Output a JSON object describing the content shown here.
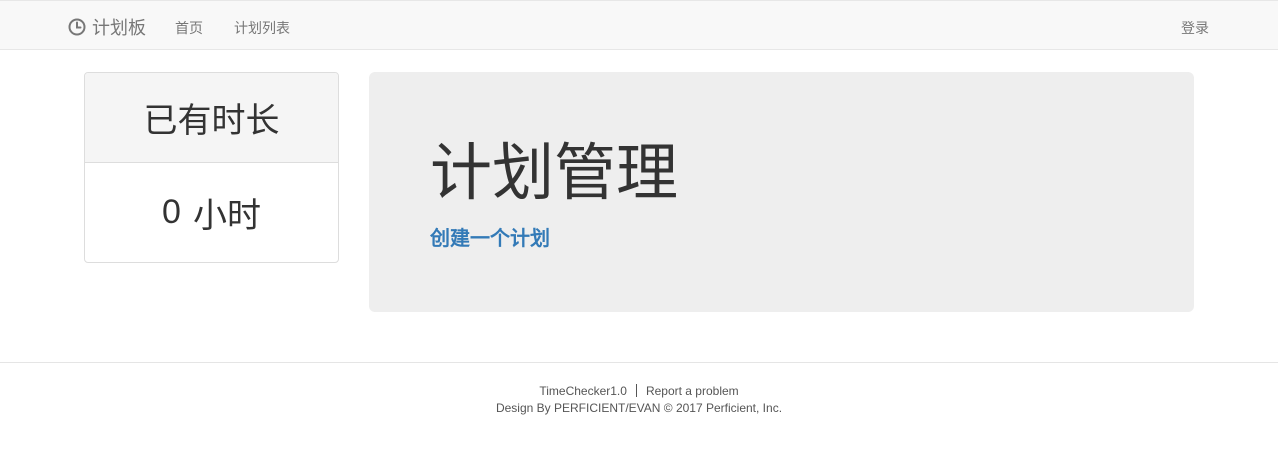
{
  "navbar": {
    "brand_icon": "clock-icon",
    "brand_label": "计划板",
    "home_label": "首页",
    "plan_list_label": "计划列表",
    "login_label": "登录"
  },
  "hours_panel": {
    "heading": "已有时长",
    "value": "0",
    "unit": "小时"
  },
  "jumbotron": {
    "title": "计划管理",
    "create_link": "创建一个计划"
  },
  "footer": {
    "app_version": "TimeChecker1.0",
    "report_link": "Report a problem",
    "credits": "Design By PERFICIENT/EVAN © 2017 Perficient, Inc."
  },
  "colors": {
    "navbar_bg": "#f8f8f8",
    "link_blue": "#337ab7",
    "jumbotron_bg": "#eeeeee"
  }
}
